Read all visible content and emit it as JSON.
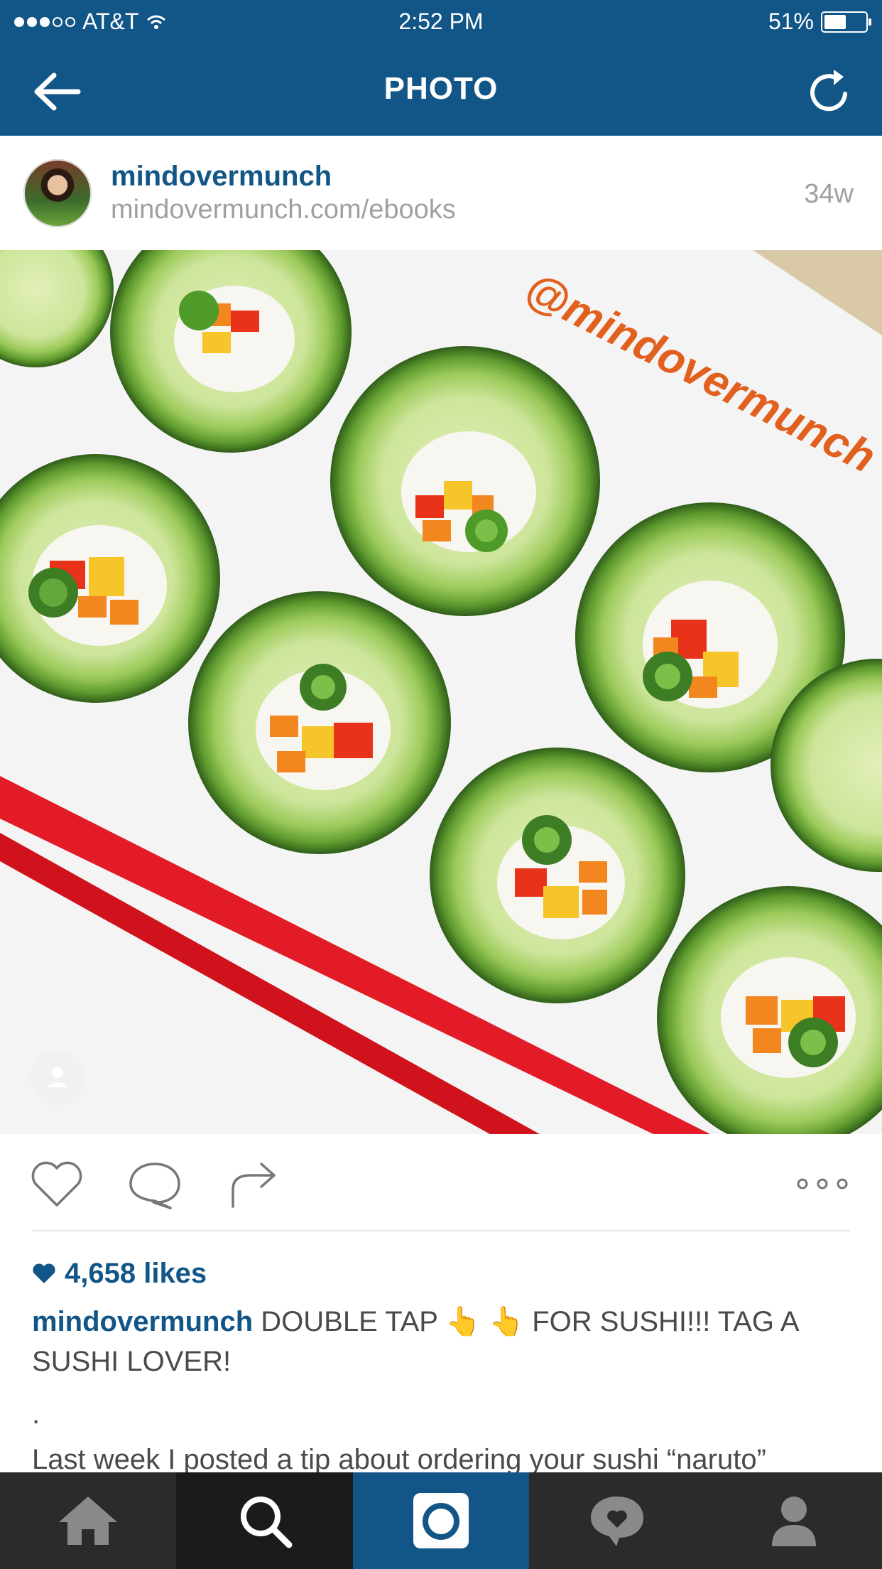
{
  "status_bar": {
    "carrier": "AT&T",
    "time": "2:52 PM",
    "battery": "51%"
  },
  "nav": {
    "title": "PHOTO",
    "back_icon": "back-arrow-icon",
    "refresh_icon": "refresh-icon"
  },
  "post": {
    "username": "mindovermunch",
    "website": "mindovermunch.com/ebooks",
    "time_ago": "34w",
    "photo_watermark": "@mindovermunch",
    "likes": "4,658 likes",
    "caption_user": "mindovermunch",
    "caption_text": "DOUBLE TAP 👆 👆  FOR SUSHI!!! TAG A SUSHI LOVER!",
    "caption_dot": ".",
    "caption_more": "Last week I posted a tip about ordering your sushi “naruto”"
  },
  "actions": {
    "like_icon": "heart-icon",
    "comment_icon": "comment-icon",
    "share_icon": "share-icon",
    "more_icon": "more-icon"
  },
  "tabbar": {
    "tabs": [
      "home-icon",
      "search-icon",
      "camera-icon",
      "activity-icon",
      "profile-icon"
    ]
  },
  "colors": {
    "brand_blue": "#125688",
    "tab_dark": "#2b2b2b",
    "muted_text": "#a0a0a0",
    "chopstick_red": "#e21b26",
    "cucumber_green": "#6fa83a"
  }
}
